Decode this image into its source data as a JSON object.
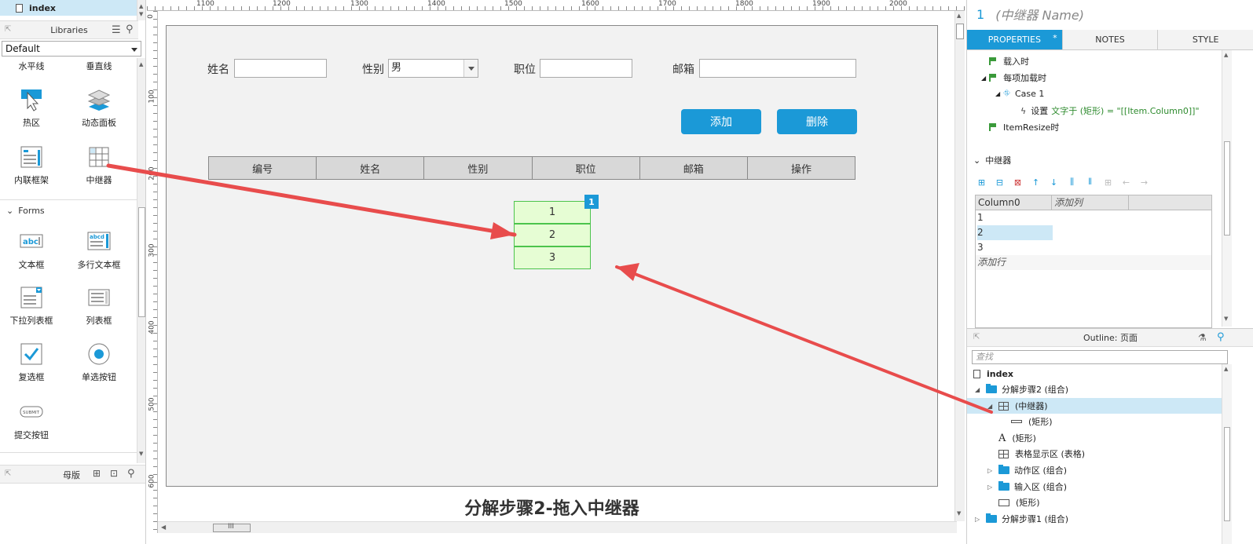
{
  "left_panel": {
    "page_item": "index",
    "libraries_title": "Libraries",
    "library_select": "Default",
    "widgets_top": [
      "水平线",
      "垂直线"
    ],
    "widgets": [
      {
        "label": "热区",
        "icon": "hotspot-icon"
      },
      {
        "label": "动态面板",
        "icon": "dynamic-panel-icon"
      },
      {
        "label": "内联框架",
        "icon": "inline-frame-icon"
      },
      {
        "label": "中继器",
        "icon": "repeater-icon"
      }
    ],
    "forms_title": "Forms",
    "forms": [
      {
        "label": "文本框",
        "icon": "text-field-icon"
      },
      {
        "label": "多行文本框",
        "icon": "text-area-icon"
      },
      {
        "label": "下拉列表框",
        "icon": "droplist-icon"
      },
      {
        "label": "列表框",
        "icon": "list-box-icon"
      },
      {
        "label": "复选框",
        "icon": "checkbox-icon"
      },
      {
        "label": "单选按钮",
        "icon": "radio-button-icon"
      },
      {
        "label": "提交按钮",
        "icon": "submit-button-icon"
      }
    ],
    "masters_title": "母版"
  },
  "canvas": {
    "ruler_top": [
      "1100",
      "1200",
      "1300",
      "1400",
      "1500",
      "1600",
      "1700",
      "1800",
      "1900",
      "2000"
    ],
    "ruler_left": [
      "0",
      "100",
      "200",
      "300",
      "400",
      "500",
      "600"
    ],
    "form": {
      "name_label": "姓名",
      "gender_label": "性别",
      "gender_value": "男",
      "position_label": "职位",
      "email_label": "邮箱"
    },
    "buttons": {
      "add": "添加",
      "delete": "删除"
    },
    "table_headers": [
      "编号",
      "姓名",
      "性别",
      "职位",
      "邮箱",
      "操作"
    ],
    "repeater_rows": [
      "1",
      "2",
      "3"
    ],
    "repeater_badge": "1",
    "caption": "分解步骤2-拖入中继器",
    "hscroll_thumb": "III"
  },
  "right_panel": {
    "widget_number": "1",
    "widget_name": "(中继器 Name)",
    "tabs": [
      "PROPERTIES",
      "NOTES",
      "STYLE"
    ],
    "tab_star": "*",
    "events": {
      "on_load": "载入时",
      "on_item_load": "每项加载时",
      "case1": "Case 1",
      "action_prefix": "设置",
      "action_detail": "文字于 (矩形) = \"[[Item.Column0]]\"",
      "on_resize": "ItemResize时"
    },
    "repeater_section": "中继器",
    "grid": {
      "col_header": "Column0",
      "add_col": "添加列",
      "rows": [
        "1",
        "2",
        "3"
      ],
      "add_row": "添加行"
    },
    "outline": {
      "title": "Outline: 页面",
      "search_placeholder": "查找",
      "items": [
        {
          "label": "index"
        },
        {
          "label": "分解步骤2 (组合)"
        },
        {
          "label": "(中继器)"
        },
        {
          "label": "(矩形)"
        },
        {
          "label": "(矩形)"
        },
        {
          "label": "表格显示区 (表格)"
        },
        {
          "label": "动作区 (组合)"
        },
        {
          "label": "输入区 (组合)"
        },
        {
          "label": "(矩形)"
        },
        {
          "label": "分解步骤1 (组合)"
        }
      ]
    }
  },
  "colors": {
    "accent": "#1b99d7",
    "arrow": "#e84c4c",
    "repeater_fill": "#e6fdd4",
    "repeater_border": "#4cc44c"
  }
}
